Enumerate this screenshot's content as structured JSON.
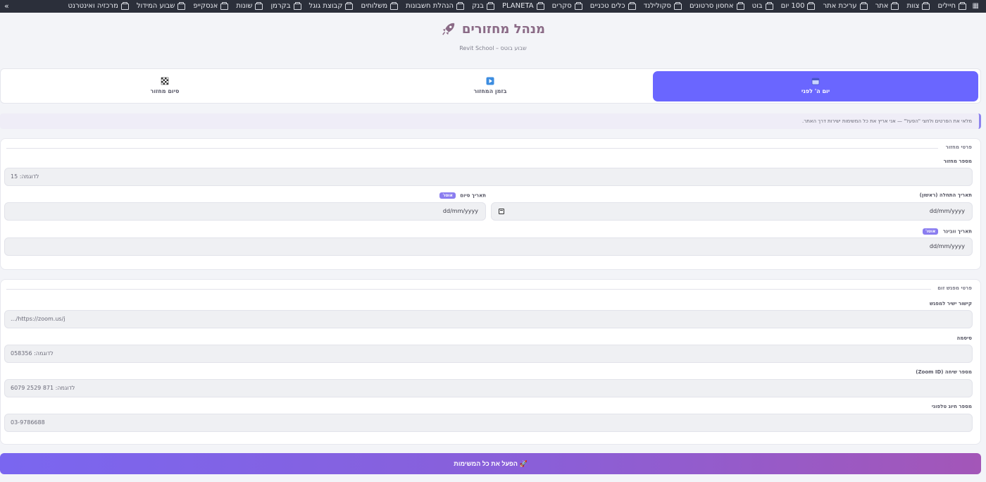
{
  "bookmarks": {
    "items": [
      "חיילים",
      "צוות",
      "אתר",
      "עריכת אתר",
      "100 יום",
      "בוט",
      "אחסון סרטונים",
      "סקולילנד",
      "כלים טכניים",
      "סקרים",
      "PLANETA",
      "בנק",
      "הנהלת חשבונות",
      "משלוחים",
      "קבוצת גוגל",
      "בקרמן",
      "שונות",
      "אנסקייפ",
      "שבוע המידול",
      "מרכזיה ואינטרנט"
    ],
    "more": "»"
  },
  "header": {
    "title": "מנהל מחזורים",
    "subtitle": "Revit School – שבוע בוטס"
  },
  "tabs": [
    {
      "label": "יום ה' לפני",
      "icon": "calendar-icon",
      "active": true
    },
    {
      "label": "בזמן המחזור",
      "icon": "play-icon",
      "active": false
    },
    {
      "label": "סיום מחזור",
      "icon": "checkered-flag-icon",
      "active": false
    }
  ],
  "info": "מלאי את הפרטים ולחצי \"הפעל\" — אני אריץ את כל המשימות ישירות דרך האתר.",
  "cycle_section": {
    "heading": "פרטי מחזור",
    "cycle_number": {
      "label": "מספר מחזור",
      "placeholder": "לדוגמה: 15"
    },
    "start_date": {
      "label": "תאריך התחלה (ראשון)",
      "value": "dd/mm/yyyy"
    },
    "end_date": {
      "label": "תאריך סיום",
      "badge": "אוטו'",
      "value": "dd/mm/yyyy"
    },
    "webinar_date": {
      "label": "תאריך וובינר",
      "badge": "אוטו'",
      "value": "dd/mm/yyyy"
    }
  },
  "zoom_section": {
    "heading": "פרטי מפגש זום",
    "link": {
      "label": "קישור ישיר למפגש",
      "placeholder": "https://zoom.us/j/..."
    },
    "password": {
      "label": "סיסמה",
      "placeholder": "לדוגמה: 058356"
    },
    "zoom_id": {
      "label": "מספר שיחה (Zoom ID)",
      "placeholder": "לדוגמה: 871 2529 6079"
    },
    "phone": {
      "label": "מספר חיוג טלפוני",
      "placeholder": "03-9786688"
    }
  },
  "launch_button": "🚀 הפעל את כל המשימות",
  "colors": {
    "accent": "#6a66ff",
    "title": "#8a6a86",
    "launch_gradient_start": "#7a66f0",
    "launch_gradient_end": "#a356b8"
  }
}
